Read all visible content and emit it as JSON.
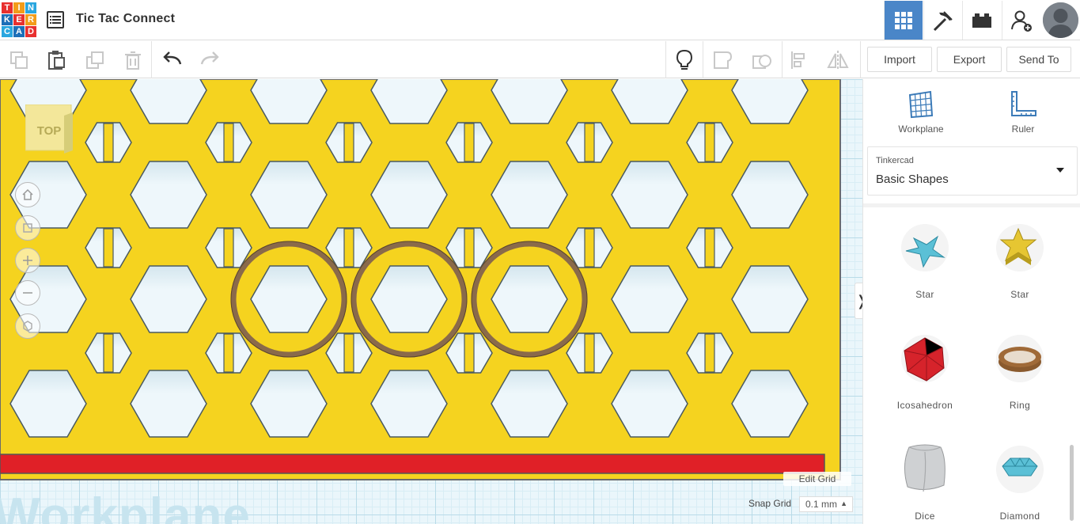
{
  "app": {
    "logo_letters": [
      "T",
      "I",
      "N",
      "K",
      "E",
      "R",
      "C",
      "A",
      "D"
    ],
    "logo_colors": [
      "#e8302f",
      "#f39c1a",
      "#2aa6df",
      "#1d6fb8",
      "#e8302f",
      "#f39c1a",
      "#2aa6df",
      "#1d6fb8",
      "#e8302f"
    ],
    "title": "Tic Tac Connect",
    "accent": "#4a86c8"
  },
  "header": {
    "icons": [
      "3d-design-grid-icon",
      "codeblocks-pickaxe-icon",
      "bricks-icon",
      "add-user-icon",
      "profile-avatar"
    ]
  },
  "toolbar": {
    "left_tools": [
      "copy-icon",
      "paste-icon",
      "duplicate-icon",
      "delete-icon",
      "undo-icon",
      "redo-icon"
    ],
    "right_tools": [
      "notes-lightbulb-icon",
      "group-icon",
      "ungroup-icon",
      "align-icon",
      "mirror-icon"
    ],
    "import_label": "Import",
    "export_label": "Export",
    "send_to_label": "Send To"
  },
  "workplane": {
    "view_cube_label": "TOP",
    "label": "Workplane",
    "board_color": "#f5d31f",
    "rim_color": "#e02027",
    "ring_color": "#8a6a4a",
    "edit_grid_label": "Edit Grid",
    "snap_grid_label": "Snap Grid",
    "snap_grid_value": "0.1 mm",
    "view_controls": [
      "home-icon",
      "fit-icon",
      "zoom-in-icon",
      "zoom-out-icon",
      "perspective-icon"
    ]
  },
  "panel": {
    "workplane_label": "Workplane",
    "ruler_label": "Ruler",
    "library_caption": "Tinkercad",
    "library_value": "Basic Shapes",
    "shapes": [
      {
        "label": "Star",
        "color": "#5bc0d6"
      },
      {
        "label": "Star",
        "color": "#e6c632"
      },
      {
        "label": "Icosahedron",
        "color": "#d6232b"
      },
      {
        "label": "Ring",
        "color": "#8a5a2e"
      },
      {
        "label": "Dice",
        "color": "#cfd1d3"
      },
      {
        "label": "Diamond",
        "color": "#5bc0d6"
      }
    ]
  }
}
